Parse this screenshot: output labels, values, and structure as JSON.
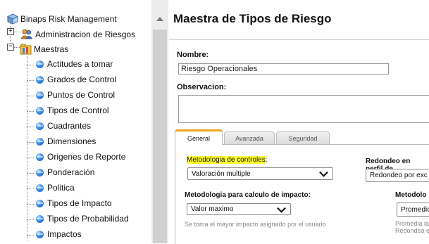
{
  "tree": {
    "root": "Binaps Risk Management",
    "admin": "Administracion de Riesgos",
    "maestras": "Maestras",
    "items": [
      "Actitudes a tomar",
      "Grados de Control",
      "Puntos de Control",
      "Tipos de Control",
      "Cuadrantes",
      "Dimensiones",
      "Origenes de Reporte",
      "Ponderación",
      "Politica",
      "Tipos de Impacto",
      "Tipos de Probabilidad",
      "Impactos"
    ],
    "expand_plus": "+",
    "expand_minus": "−"
  },
  "main": {
    "title": "Maestra de Tipos de Riesgo",
    "nombre_label": "Nombre:",
    "nombre_value": "Riesgo Operacionales",
    "observacion_label": "Observacion:",
    "tabs": [
      "General",
      "Avanzada",
      "Seguridad"
    ],
    "metodologia_label": "Metodologia de controles",
    "metodologia_suffix": ":",
    "metodologia_value": "Valoración multiple",
    "redondeo_label": "Redondeo en perfil de",
    "redondeo_value": "Redondeo por exc",
    "impacto_label": "Metodologia para calculo de impacto:",
    "impacto_value": "Valor maximo",
    "impacto_hint": "Se toma el mayor impacto asignado por el usuario",
    "metod2_label": "Metodolo",
    "metod2_value": "Promedio",
    "metod2_hint1": "Promedia la",
    "metod2_hint2": "Redondea e"
  }
}
